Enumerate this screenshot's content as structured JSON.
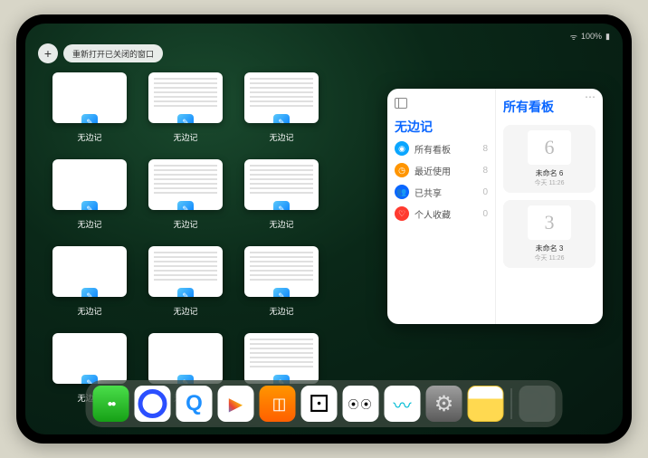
{
  "status": {
    "battery": "100%"
  },
  "controls": {
    "plus": "+",
    "reopen": "重新打开已关闭的窗口"
  },
  "window": {
    "label": "无边记"
  },
  "windows": [
    {
      "kind": "blank"
    },
    {
      "kind": "content"
    },
    {
      "kind": "content"
    },
    {
      "kind": "blank"
    },
    {
      "kind": "content"
    },
    {
      "kind": "content"
    },
    {
      "kind": "blank"
    },
    {
      "kind": "content"
    },
    {
      "kind": "content"
    },
    {
      "kind": "blank"
    },
    {
      "kind": "blank"
    },
    {
      "kind": "content"
    }
  ],
  "panel": {
    "sidebar_title": "无边记",
    "categories": [
      {
        "label": "所有看板",
        "count": "8",
        "color": "#0aa6ff",
        "glyph": "◉"
      },
      {
        "label": "最近使用",
        "count": "8",
        "color": "#ff9500",
        "glyph": "◷"
      },
      {
        "label": "已共享",
        "count": "0",
        "color": "#0a66ff",
        "glyph": "👥"
      },
      {
        "label": "个人收藏",
        "count": "0",
        "color": "#ff3b30",
        "glyph": "♡"
      }
    ],
    "boards_title": "所有看板",
    "boards": [
      {
        "glyph": "6",
        "name": "未命名 6",
        "time": "今天 11:26"
      },
      {
        "glyph": "3",
        "name": "未命名 3",
        "time": "今天 11:26"
      }
    ]
  },
  "dock": {
    "items": [
      {
        "name": "wechat",
        "className": "di-wechat"
      },
      {
        "name": "quark",
        "className": "di-quark"
      },
      {
        "name": "qq-browser",
        "className": "di-qq"
      },
      {
        "name": "play",
        "className": "di-play"
      },
      {
        "name": "books",
        "className": "di-books"
      },
      {
        "name": "dice",
        "className": "di-dice"
      },
      {
        "name": "camo",
        "className": "di-dots"
      },
      {
        "name": "freeform",
        "className": "di-freeform"
      },
      {
        "name": "settings",
        "className": "di-settings"
      },
      {
        "name": "notes",
        "className": "di-notes"
      }
    ]
  }
}
